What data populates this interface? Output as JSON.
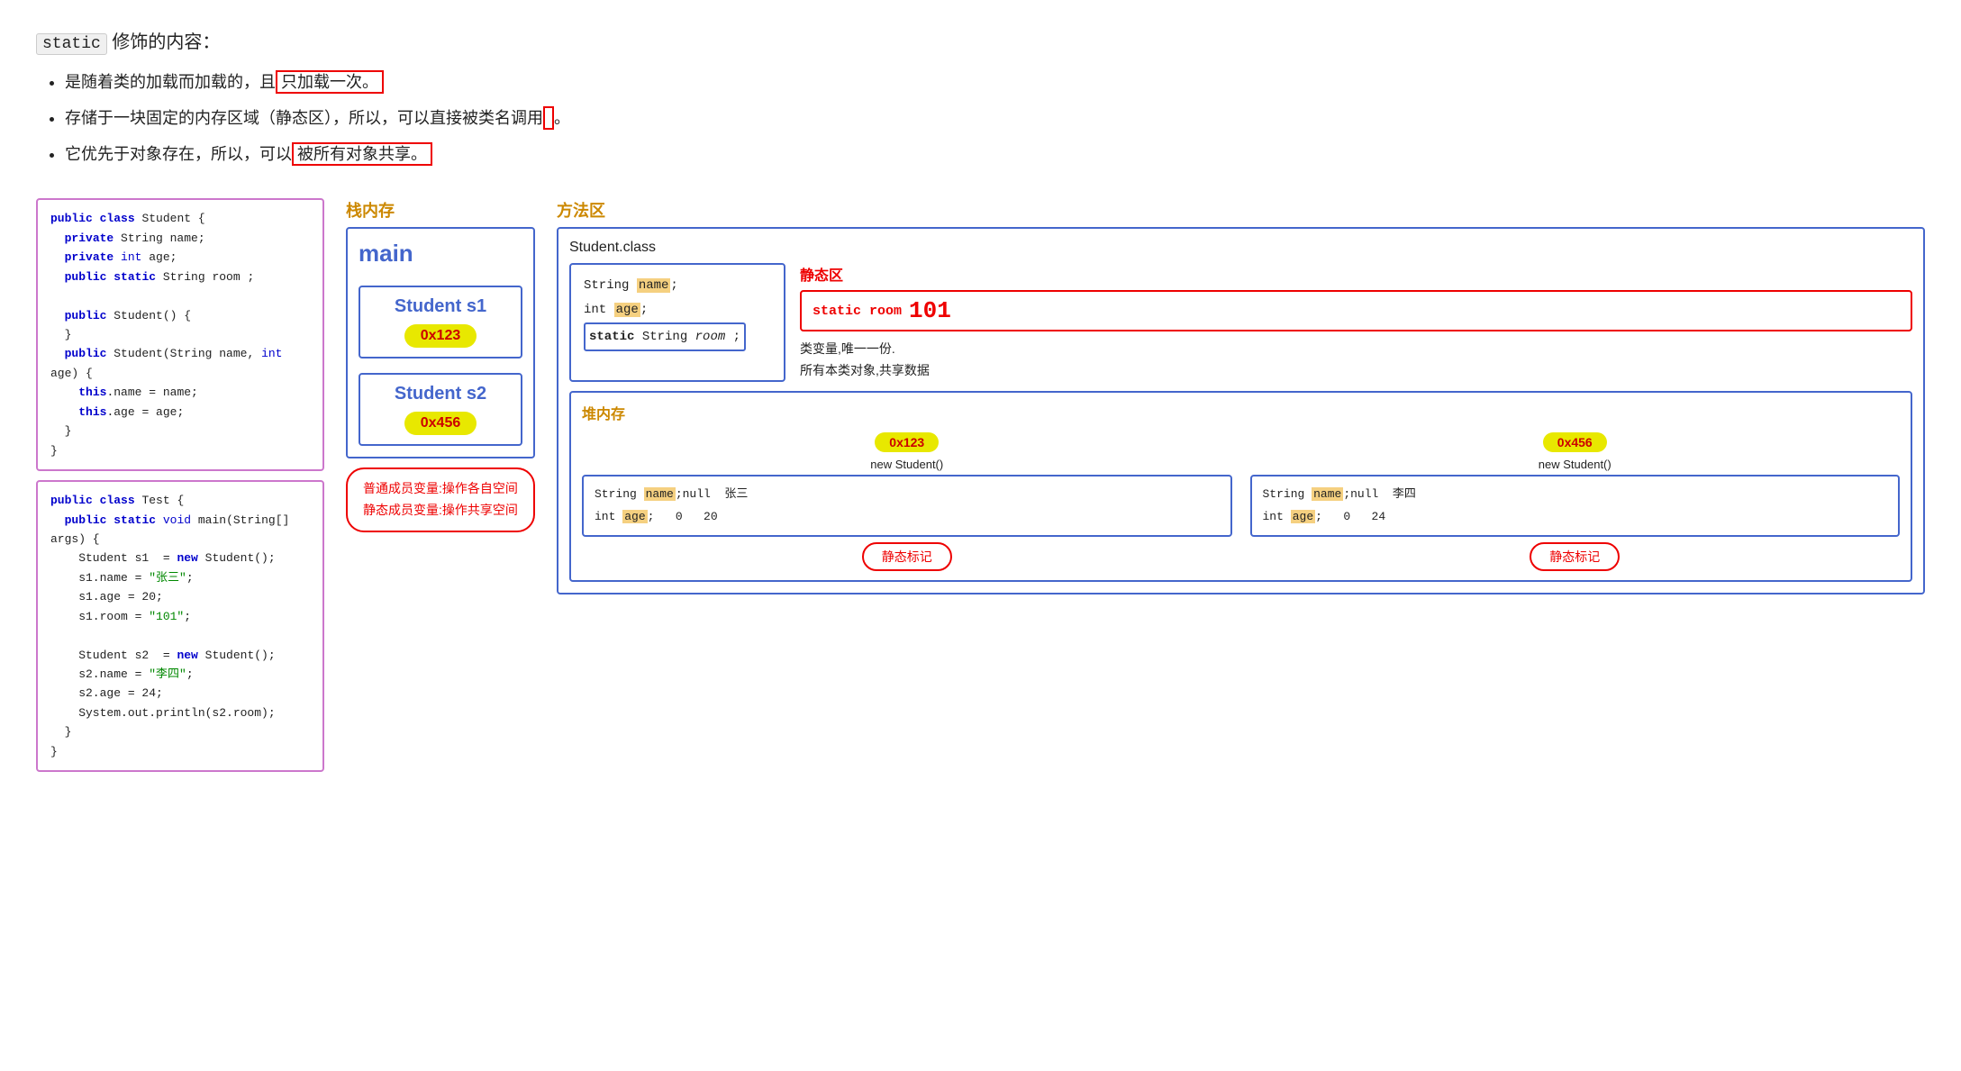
{
  "header": {
    "title_prefix": "static",
    "title_suffix": " 修饰的内容："
  },
  "bullets": [
    {
      "text_before": "是随着类的加载而加载的，且",
      "text_highlight": "只加载一次。",
      "text_after": ""
    },
    {
      "text_before": "存储于一块固定的内存区域（静态区），所以，可以直接被类名调用",
      "text_highlight": "",
      "text_after": "。"
    },
    {
      "text_before": "它优先于对象存在，所以，可以",
      "text_highlight": "被所有对象共享。",
      "text_after": ""
    }
  ],
  "code_student": [
    "public class Student {",
    "    private String name;",
    "    private int age;",
    "    public static String room ;",
    "",
    "    public Student() {",
    "    }",
    "    public Student(String name, int age) {",
    "        this.name = name;",
    "        this.age = age;",
    "    }",
    "}"
  ],
  "code_test": [
    "public class Test {",
    "    public static void main(String[] args) {",
    "        Student s1  = new Student();",
    "        s1.name = \"张三\";",
    "        s1.age = 20;",
    "        s1.room = \"101\";",
    "",
    "        Student s2  = new Student();",
    "        s2.name = \"李四\";",
    "        s2.age = 24;",
    "        System.out.println(s2.room);",
    "    }",
    "}"
  ],
  "stack": {
    "title": "栈内存",
    "main_label": "main",
    "s1_label": "Student s1",
    "s1_addr": "0x123",
    "s2_label": "Student s2",
    "s2_addr": "0x456"
  },
  "method": {
    "title": "方法区",
    "class_label": "Student.class",
    "fields": {
      "name": "String",
      "name_hl": "name",
      "age": "int",
      "age_hl": "age",
      "static_kw": "static",
      "static_type": "String",
      "static_field": "room"
    },
    "static_area": {
      "title": "静态区",
      "content": "static room",
      "value": "101",
      "desc1": "类变量,唯一一份.",
      "desc2": "所有本类对象,共享数据"
    }
  },
  "heap": {
    "title": "堆内存",
    "obj1": {
      "addr": "0x123",
      "label": "new Student()",
      "name_field": "String",
      "name_hl": "name",
      "name_val1": ";null",
      "name_val2": "张三",
      "age_field": "int",
      "age_hl": "age",
      "age_val1": ";",
      "age_val2": "0",
      "age_val3": "20",
      "static_badge": "静态标记"
    },
    "obj2": {
      "addr": "0x456",
      "label": "new Student()",
      "name_field": "String",
      "name_hl": "name",
      "name_val1": ";null",
      "name_val2": "李四",
      "age_field": "int",
      "age_hl": "age",
      "age_val1": ";",
      "age_val2": "0",
      "age_val3": "24",
      "static_badge": "静态标记"
    }
  },
  "bottom_note": {
    "line1": "普通成员变量:操作各自空间",
    "line2": "静态成员变量:操作共享空间"
  }
}
